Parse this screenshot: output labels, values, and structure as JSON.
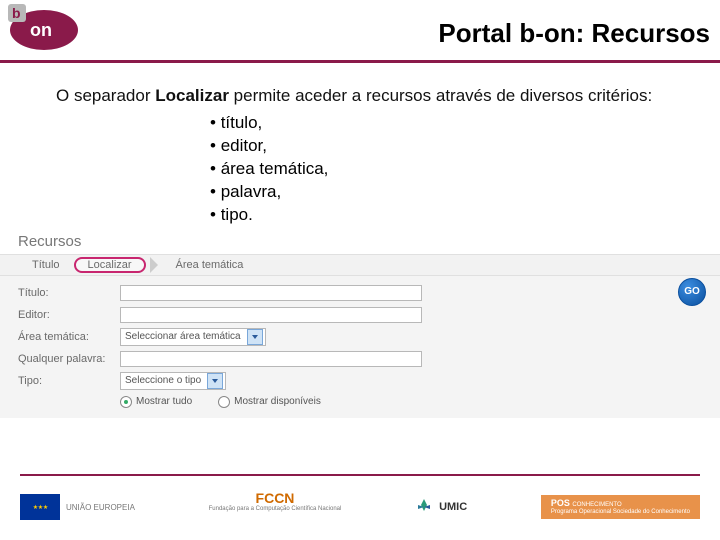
{
  "header": {
    "title": "Portal b-on: Recursos",
    "logo_alt": "b-on"
  },
  "intro": {
    "prefix": "O separador ",
    "bold": "Localizar",
    "suffix": " permite aceder a recursos através de diversos critérios:"
  },
  "bullets": [
    "título,",
    "editor,",
    "área temática,",
    "palavra,",
    "tipo."
  ],
  "section_label": "Recursos",
  "tabs": {
    "t1": "Título",
    "t2": "Localizar",
    "t3": "Área temática"
  },
  "form": {
    "titulo_label": "Título:",
    "editor_label": "Editor:",
    "area_label": "Área temática:",
    "area_value": "Seleccionar área temática",
    "palavra_label": "Qualquer palavra:",
    "tipo_label": "Tipo:",
    "tipo_value": "Seleccione o tipo",
    "radio1": "Mostrar tudo",
    "radio2": "Mostrar disponíveis",
    "go": "GO"
  },
  "footer": {
    "eu": "UNIÃO EUROPEIA",
    "fccn": "FCCN",
    "fccn_sub": "Fundação para a Computação Científica Nacional",
    "umic": "UMIC",
    "pos1": "POS",
    "pos2": "CONHECIMENTO",
    "pos3": "Programa Operacional Sociedade do Conhecimento"
  }
}
